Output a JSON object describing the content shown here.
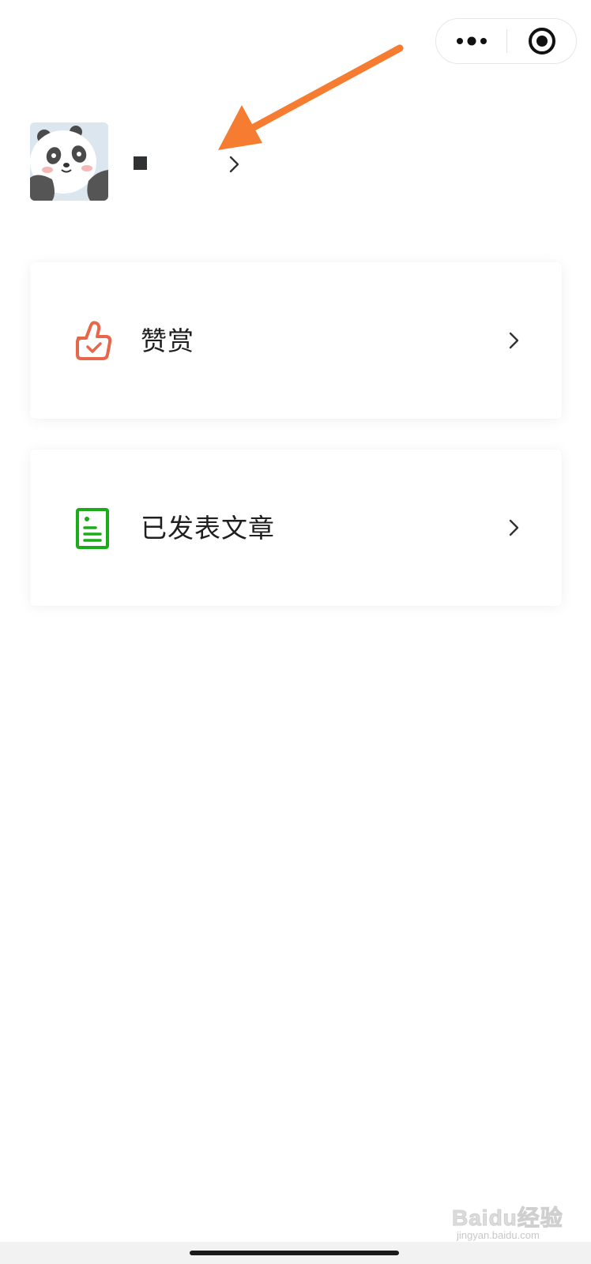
{
  "capsule": {
    "more_icon": "more-dots-icon",
    "close_icon": "target-close-icon"
  },
  "profile": {
    "nickname": "",
    "avatar": "panda-avatar"
  },
  "menu": {
    "items": [
      {
        "label": "赞赏",
        "icon": "thumbs-up-icon",
        "color": "#e8674a"
      },
      {
        "label": "已发表文章",
        "icon": "document-icon",
        "color": "#1aad19"
      }
    ]
  },
  "watermark": {
    "logo": "Baidu经验",
    "url": "jingyan.baidu.com"
  },
  "colors": {
    "annotation_arrow": "#f57c30",
    "reward_icon": "#e8674a",
    "article_icon": "#1aad19"
  }
}
